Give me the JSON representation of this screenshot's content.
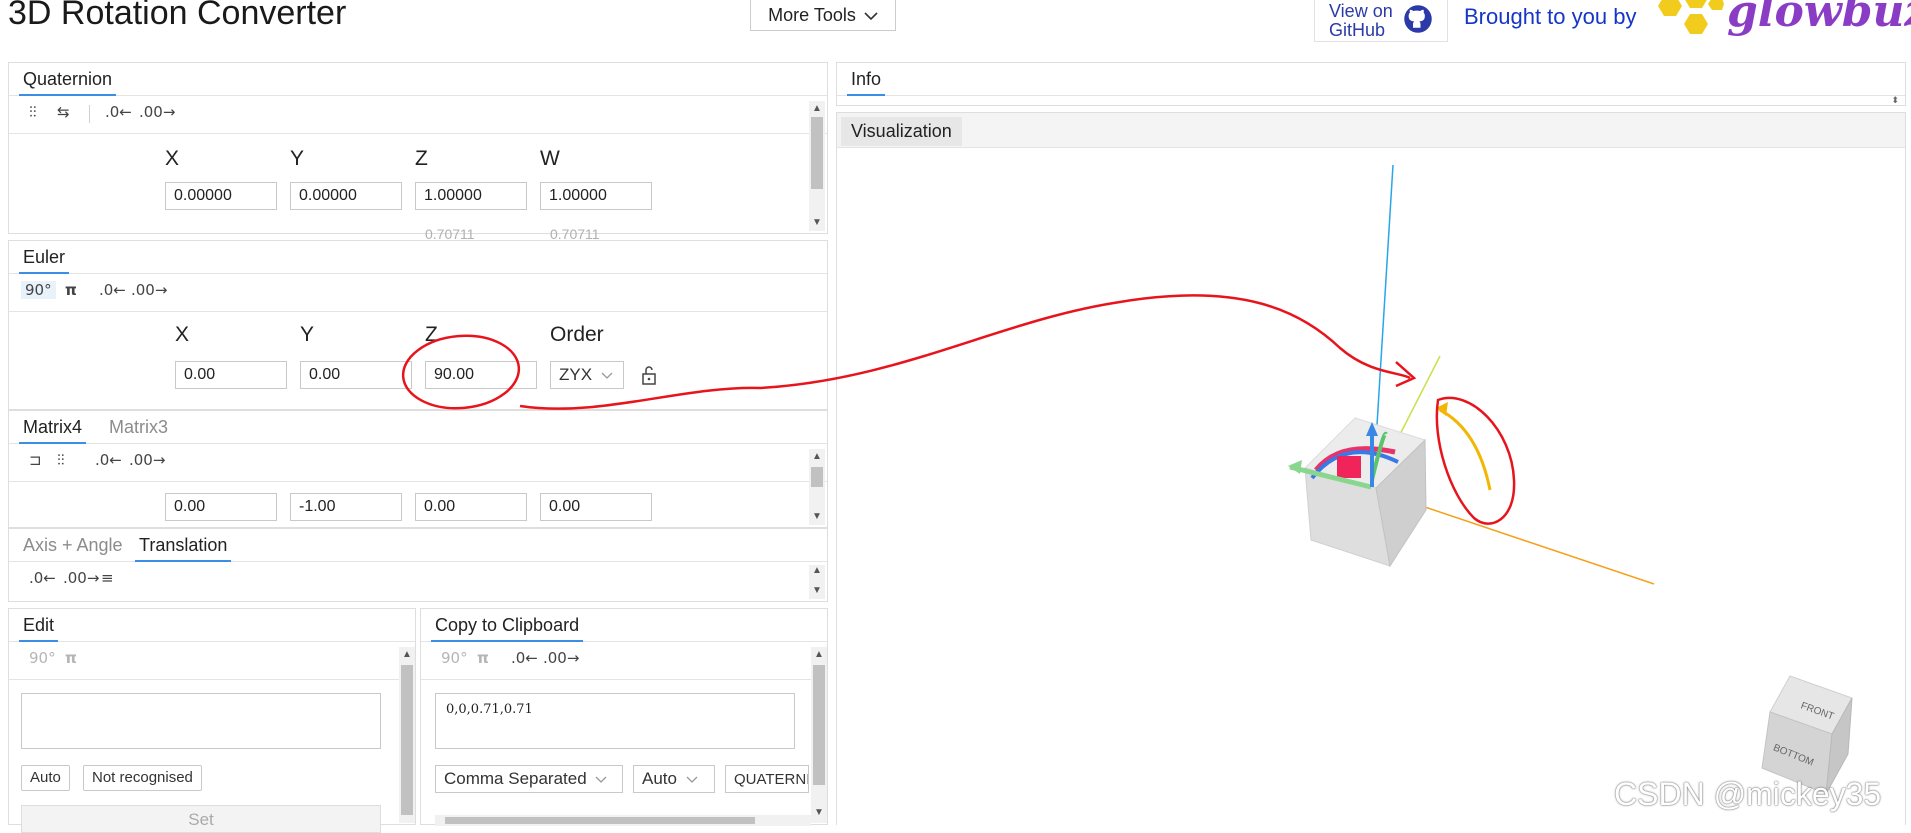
{
  "header": {
    "title": "3D Rotation Converter",
    "more_tools": "More Tools",
    "github_line1": "View on",
    "github_line2": "GitHub",
    "brought": "Brought to you by",
    "logo": "glowbuzzer"
  },
  "quaternion": {
    "tab": "Quaternion",
    "labels": [
      "X",
      "Y",
      "Z",
      "W"
    ],
    "values": [
      "0.00000",
      "0.00000",
      "1.00000",
      "1.00000"
    ],
    "ghost": [
      "0.70711",
      "0.70711"
    ]
  },
  "euler": {
    "tab": "Euler",
    "labels": [
      "X",
      "Y",
      "Z",
      "Order"
    ],
    "values": [
      "0.00",
      "0.00",
      "90.00"
    ],
    "order": "ZYX",
    "toolbar": [
      "90°",
      "π"
    ]
  },
  "matrix": {
    "tabs": [
      "Matrix4",
      "Matrix3"
    ],
    "values": [
      "0.00",
      "-1.00",
      "0.00",
      "0.00"
    ]
  },
  "axis_tabs": [
    "Axis + Angle",
    "Translation"
  ],
  "edit": {
    "tab": "Edit",
    "toolbar": [
      "90°",
      "π"
    ],
    "auto": "Auto",
    "status": "Not recognised",
    "set": "Set"
  },
  "clipboard": {
    "tab": "Copy to Clipboard",
    "toolbar": [
      "90°",
      "π"
    ],
    "text": "0,0,0.71,0.71",
    "format": "Comma Separated",
    "auto": "Auto",
    "type": "QUATERNIO"
  },
  "info": {
    "tab": "Info"
  },
  "viz": {
    "tab": "Visualization",
    "cube_front": "FRONT",
    "cube_bottom": "BOTTOM",
    "colors": {
      "z_axis": "#29a6e8",
      "x_axis": "#f5a01a",
      "y_axis": "#c8e04a",
      "annotation": "#e8141c"
    }
  },
  "watermark": "CSDN @mickey35"
}
